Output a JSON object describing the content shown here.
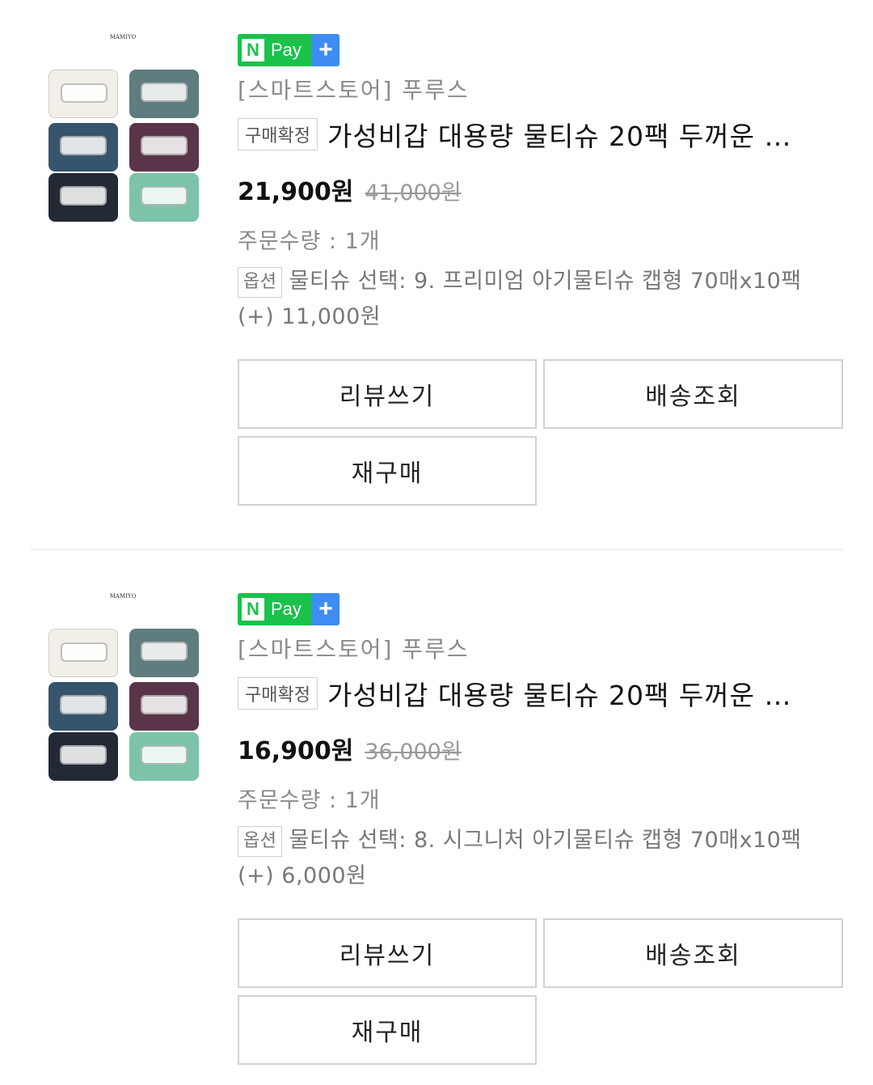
{
  "orders": [
    {
      "thumbnail": {
        "brand": "MAMIYO"
      },
      "pay_badge": {
        "n": "N",
        "pay": "Pay",
        "plus": "+"
      },
      "store": "[스마트스토어] 푸루스",
      "status_badge": "구매확정",
      "title": "가성비갑 대용량 물티슈 20팩 두꺼운 …",
      "price": "21,900원",
      "original_price": "41,000원",
      "quantity": "주문수량 : 1개",
      "option_badge": "옵션",
      "option_text": "물티슈 선택: 9. 프리미엄 아기물티슈 캡형 70매x10팩 (+) 11,000원",
      "buttons": {
        "review": "리뷰쓰기",
        "shipping": "배송조회",
        "rebuy": "재구매"
      }
    },
    {
      "thumbnail": {
        "brand": "MAMIYO"
      },
      "pay_badge": {
        "n": "N",
        "pay": "Pay",
        "plus": "+"
      },
      "store": "[스마트스토어] 푸루스",
      "status_badge": "구매확정",
      "title": "가성비갑 대용량 물티슈 20팩 두꺼운 …",
      "price": "16,900원",
      "original_price": "36,000원",
      "quantity": "주문수량 : 1개",
      "option_badge": "옵션",
      "option_text": "물티슈 선택: 8. 시그니처 아기물티슈 캡형 70매x10팩 (+) 6,000원",
      "buttons": {
        "review": "리뷰쓰기",
        "shipping": "배송조회",
        "rebuy": "재구매"
      }
    }
  ],
  "colors": {
    "npay_green": "#19c24a",
    "npay_blue": "#3f8cf2",
    "pack_colors": [
      "#f1efe8",
      "#5f7c7e",
      "#36546b",
      "#5a3549",
      "#232a36",
      "#7cc3a8"
    ]
  }
}
